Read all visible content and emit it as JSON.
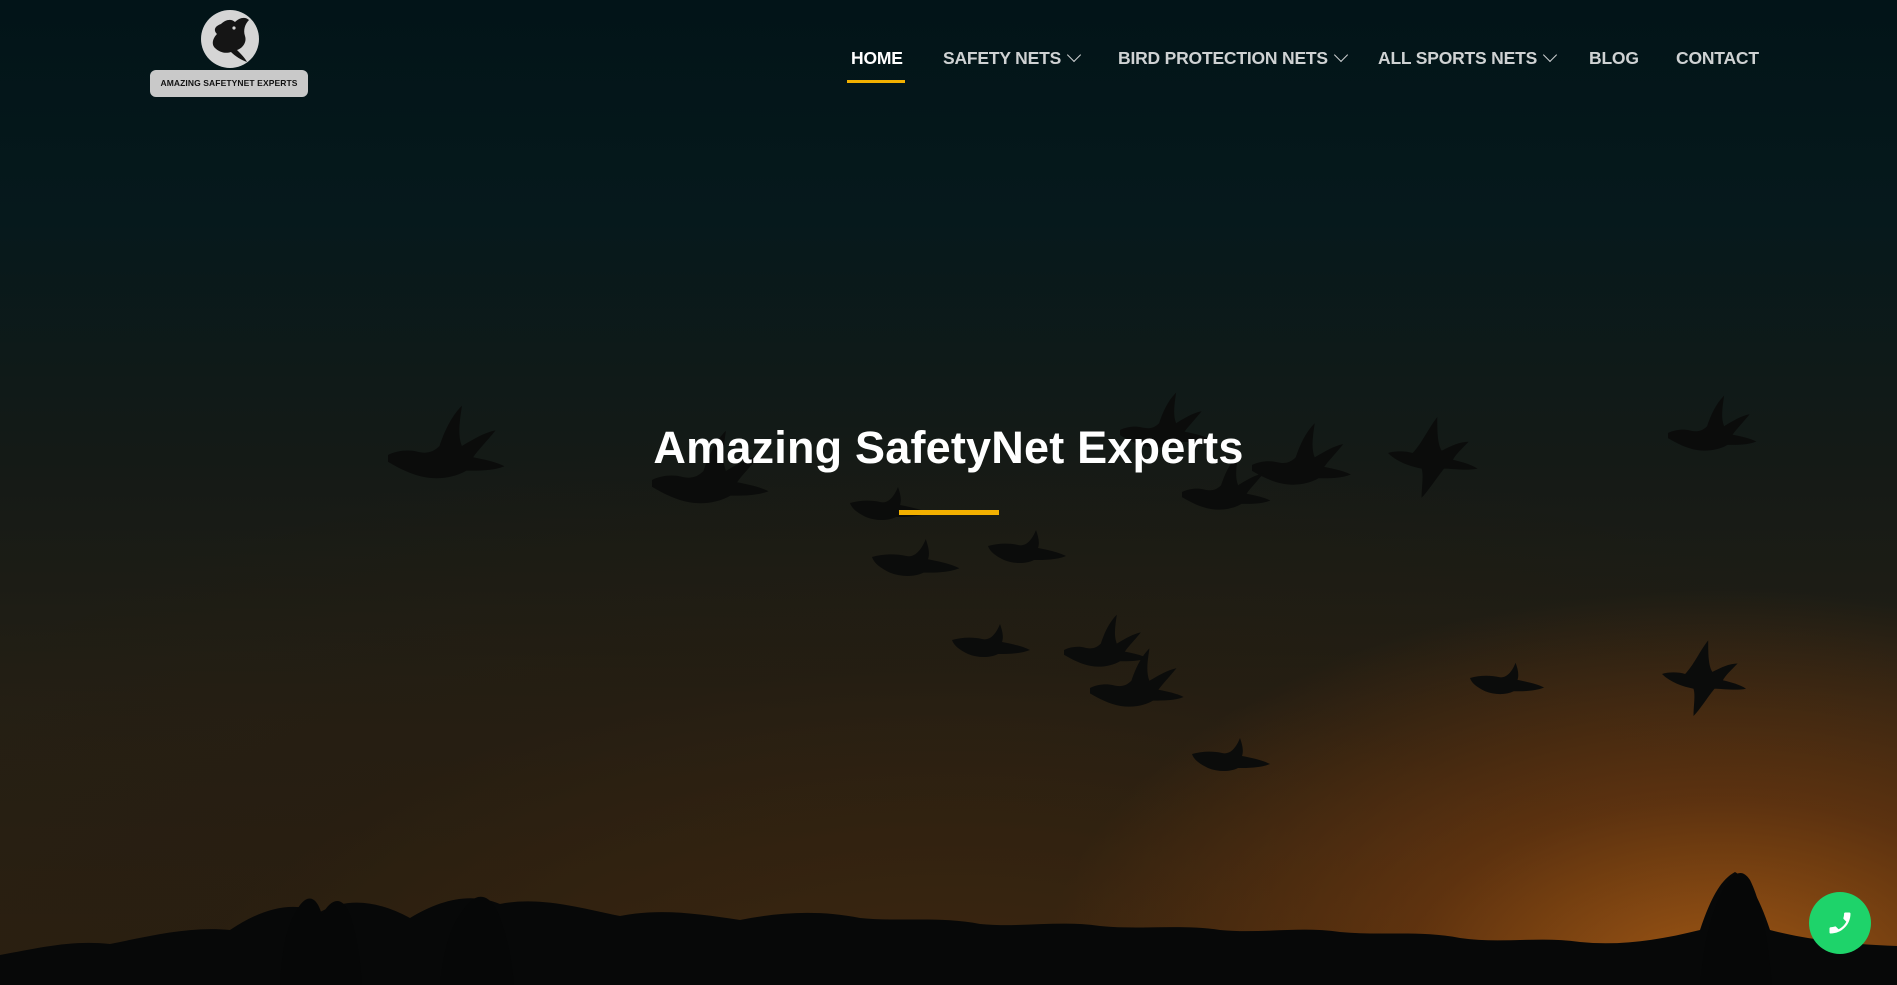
{
  "brand": {
    "logo_text": "AMAZING SAFETYNET EXPERTS",
    "logo_icon": "eagle-icon"
  },
  "nav": {
    "items": [
      {
        "label": "HOME",
        "active": true,
        "has_dropdown": false
      },
      {
        "label": "SAFETY NETS",
        "active": false,
        "has_dropdown": true
      },
      {
        "label": "BIRD PROTECTION NETS",
        "active": false,
        "has_dropdown": true
      },
      {
        "label": "ALL SPORTS NETS",
        "active": false,
        "has_dropdown": true
      },
      {
        "label": "BLOG",
        "active": false,
        "has_dropdown": false
      },
      {
        "label": "CONTACT",
        "active": false,
        "has_dropdown": false
      }
    ]
  },
  "hero": {
    "title": "Amazing SafetyNet Experts"
  },
  "floating": {
    "call_icon": "phone-icon"
  },
  "colors": {
    "accent": "#f2b000",
    "call_button": "#1ed36a",
    "nav_text": "#cfd2d3",
    "nav_active": "#ffffff"
  }
}
